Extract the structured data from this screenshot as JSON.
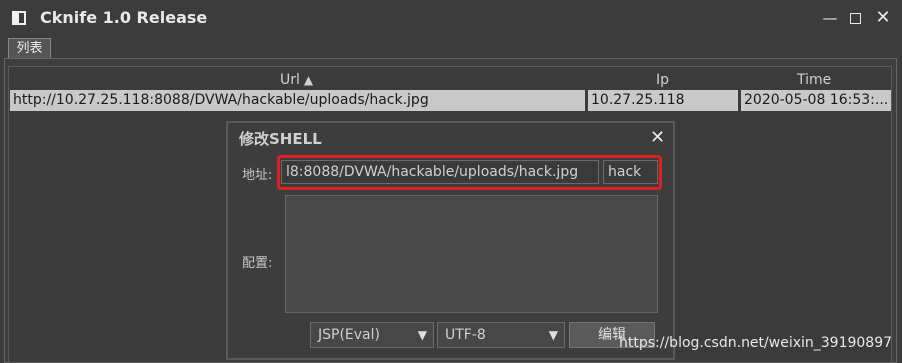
{
  "window": {
    "title": "Cknife 1.0 Release",
    "min_icon": "minimize-icon",
    "max_icon": "maximize-icon",
    "close_icon": "close-icon"
  },
  "tab": {
    "label": "列表"
  },
  "table": {
    "columns": [
      "Url",
      "Ip",
      "Time"
    ],
    "sort_icon": "sort-up-icon",
    "rows": [
      {
        "url": "http://10.27.25.118:8088/DVWA/hackable/uploads/hack.jpg",
        "ip": "10.27.25.118",
        "time": "2020-05-08 16:53:..."
      }
    ]
  },
  "dialog": {
    "title": "修改SHELL",
    "close_icon": "close-icon",
    "address_label": "地址:",
    "config_label": "配置:",
    "url_value": "l8:8088/DVWA/hackable/uploads/hack.jpg",
    "password_value": "hack",
    "type_select": "JSP(Eval)",
    "encoding_select": "UTF-8",
    "edit_button": "编辑"
  },
  "watermark": "https://blog.csdn.net/weixin_39190897",
  "colors": {
    "highlight": "#e02020",
    "background": "#3c3c3c",
    "row": "#c9c9c9"
  }
}
